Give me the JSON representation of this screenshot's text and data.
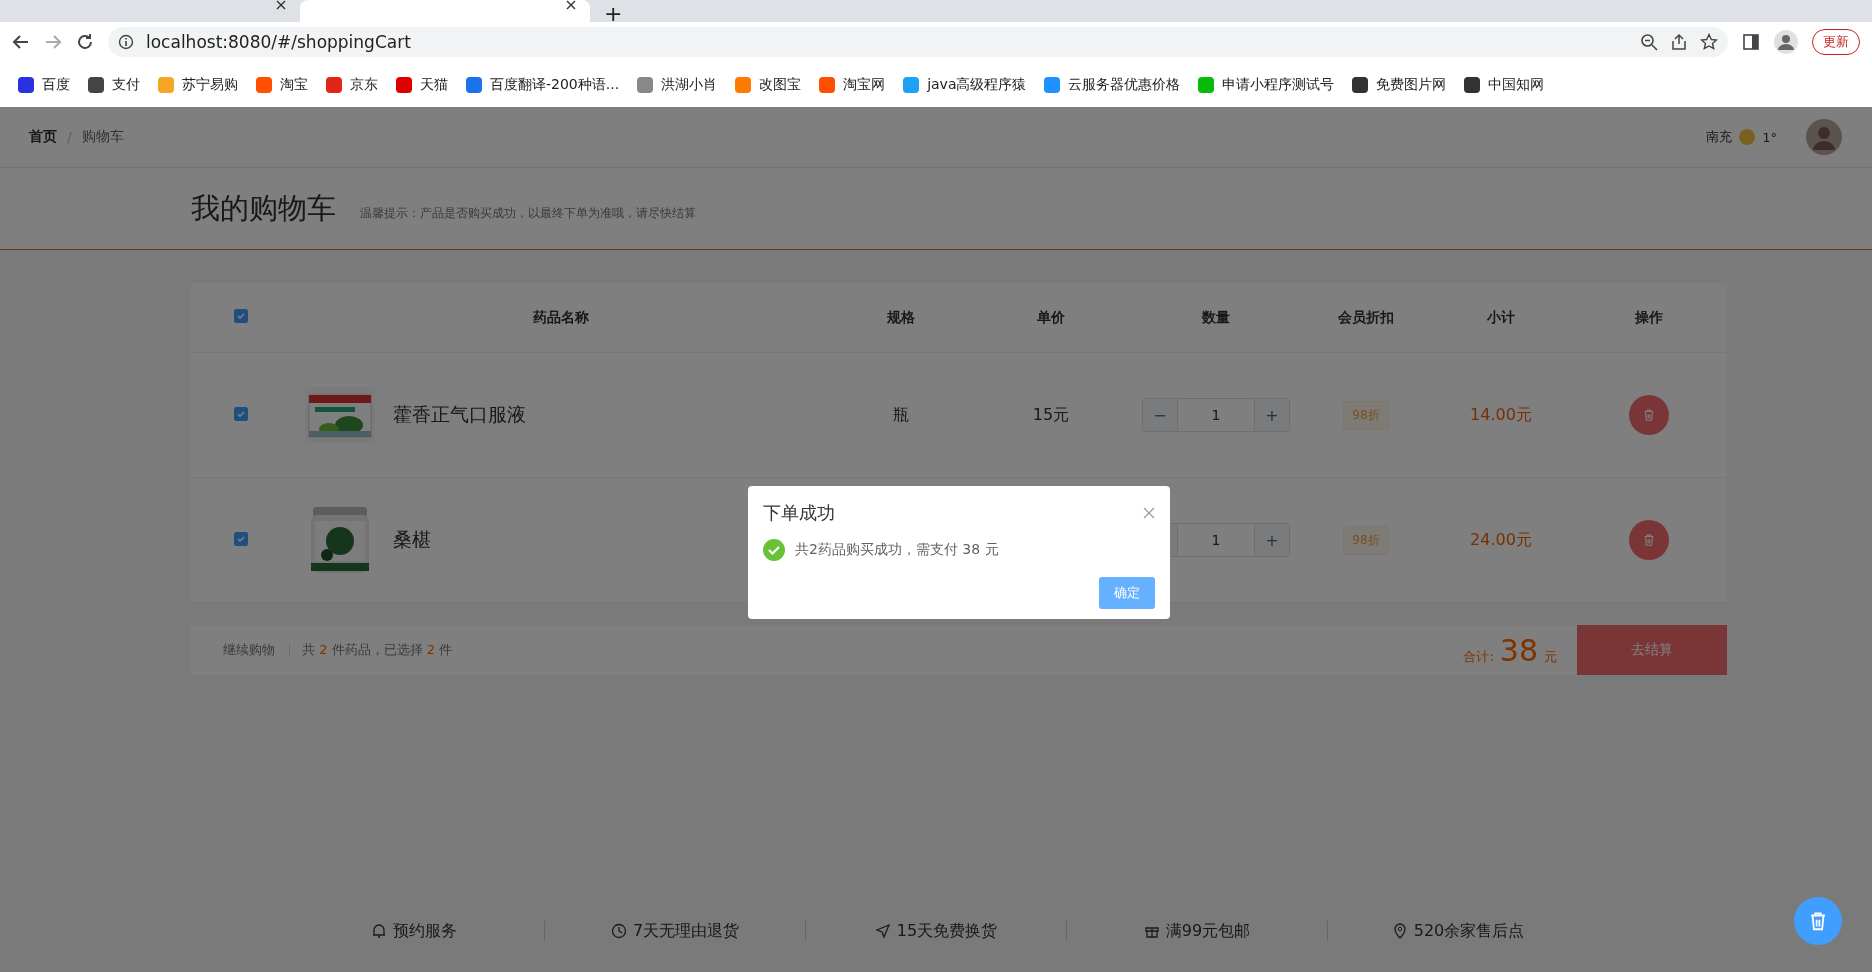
{
  "browser": {
    "tabs": [
      {
        "selected": false
      },
      {
        "selected": true
      }
    ],
    "new_tab": "+",
    "address": "localhost:8080/#/shoppingCart",
    "update_button": "更新",
    "bookmarks": [
      "百度",
      "支付",
      "苏宁易购",
      "淘宝",
      "京东",
      "天猫",
      "百度翻译-200种语...",
      "洪湖小肖",
      "改图宝",
      "淘宝网",
      "java高级程序猿",
      "云服务器优惠价格",
      "申请小程序测试号",
      "免费图片网",
      "中国知网"
    ]
  },
  "header": {
    "breadcrumb": [
      "首页",
      "购物车"
    ],
    "separator": "/",
    "city": "南充",
    "temperature": "1°"
  },
  "page_title": "我的购物车",
  "tip": "温馨提示：产品是否购买成功，以最终下单为准哦，请尽快结算",
  "table": {
    "select_all_checked": true,
    "columns": [
      "药品名称",
      "规格",
      "单价",
      "数量",
      "会员折扣",
      "小计",
      "操作"
    ],
    "rows": [
      {
        "checked": true,
        "name": "藿香正气口服液",
        "spec": "瓶",
        "price": "15元",
        "minus": "−",
        "quantity": "1",
        "plus": "+",
        "discount": "98折",
        "subtotal": "14.00元"
      },
      {
        "checked": true,
        "name": "桑椹",
        "quantity": "1",
        "plus": "+",
        "discount": "98折",
        "subtotal": "24.00元"
      }
    ]
  },
  "summary": {
    "continue": "继续购物",
    "count_prefix": "共",
    "total_count": "2",
    "count_middle": "件药品，已选择",
    "selected_count": "2",
    "count_suffix": "件",
    "total_label": "合计:",
    "total": "38",
    "unit": "元",
    "checkout": "去结算"
  },
  "footer": [
    "预约服务",
    "7天无理由退货",
    "15天免费换货",
    "满99元包邮",
    "520余家售后点"
  ],
  "dialog": {
    "title": "下单成功",
    "message": "共2药品购买成功，需支付 38 元",
    "confirm": "确定"
  }
}
